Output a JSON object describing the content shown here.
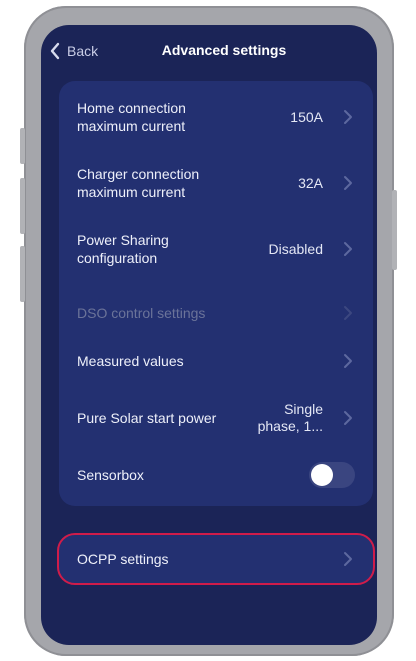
{
  "header": {
    "back_label": "Back",
    "title": "Advanced settings"
  },
  "settings": [
    {
      "label": "Home connection maximum current",
      "value": "150A",
      "chevron_icon": "chevron-right-icon"
    },
    {
      "label": "Charger connection maximum current",
      "value": "32A",
      "chevron_icon": "chevron-right-icon"
    },
    {
      "label": "Power Sharing configuration",
      "value": "Disabled",
      "chevron_icon": "chevron-right-icon"
    },
    {
      "label": "DSO control settings",
      "value": "",
      "disabled": true,
      "chevron_icon": "chevron-right-icon"
    },
    {
      "label": "Measured values",
      "value": "",
      "chevron_icon": "chevron-right-icon"
    },
    {
      "label": "Pure Solar start power",
      "value": "Single phase, 1...",
      "chevron_icon": "chevron-right-icon"
    },
    {
      "label": "Sensorbox",
      "toggle_on": false
    }
  ],
  "ocpp": {
    "label": "OCPP settings",
    "highlight_color": "#d01c4a"
  },
  "colors": {
    "screen_background": "#1b2457",
    "panel_background": "#233071",
    "phone_frame": "#a5a6ab"
  }
}
